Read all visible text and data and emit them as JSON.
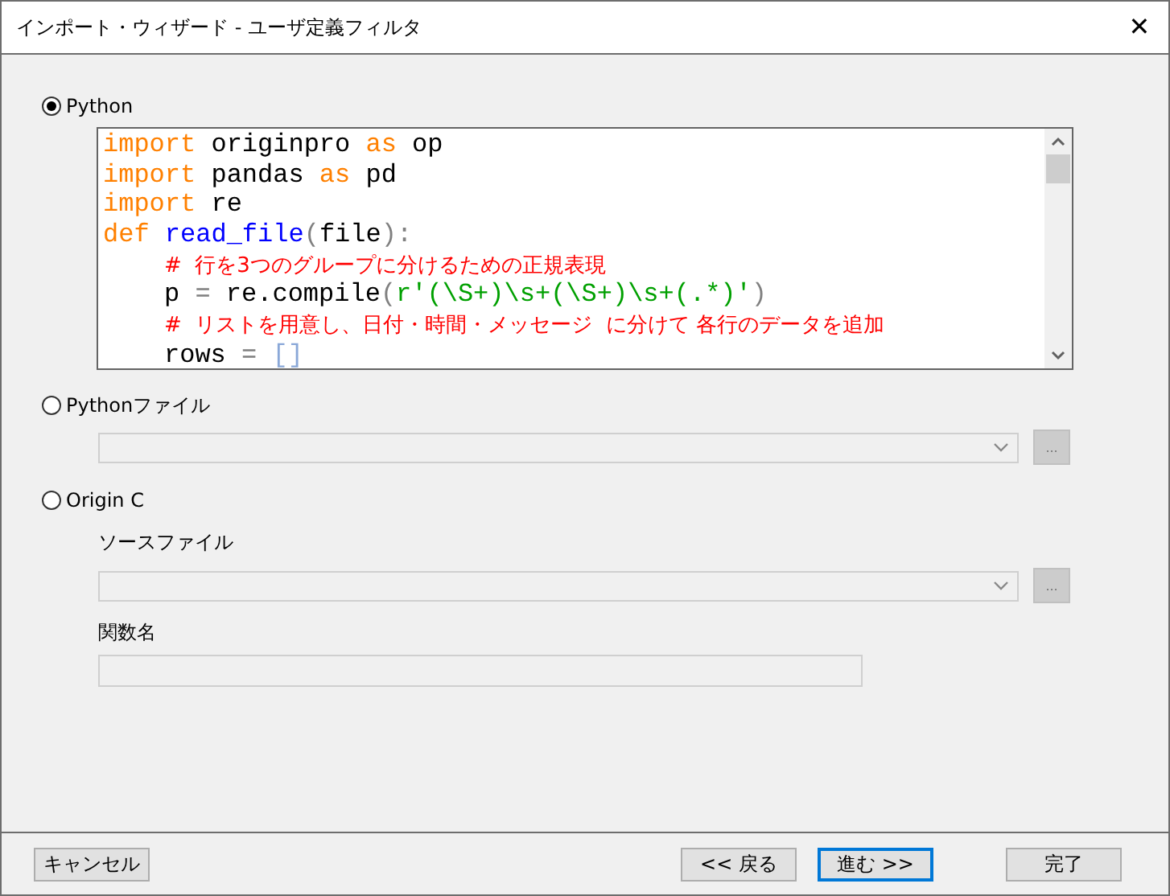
{
  "window": {
    "title": "インポート・ウィザード - ユーザ定義フィルタ",
    "close": "✕"
  },
  "sources": [
    {
      "kind": "code",
      "label": "Python",
      "selected": true,
      "code": [
        {
          "tokens": [
            {
              "kind": "kw",
              "text": "import"
            },
            {
              "kind": "id",
              "text": " originpro "
            },
            {
              "kind": "kw",
              "text": "as"
            },
            {
              "kind": "id",
              "text": " op"
            }
          ]
        },
        {
          "tokens": [
            {
              "kind": "kw",
              "text": "import"
            },
            {
              "kind": "id",
              "text": " pandas "
            },
            {
              "kind": "kw",
              "text": "as"
            },
            {
              "kind": "id",
              "text": " pd"
            }
          ]
        },
        {
          "tokens": [
            {
              "kind": "kw",
              "text": "import"
            },
            {
              "kind": "id",
              "text": " re"
            }
          ]
        },
        {
          "tokens": [
            {
              "kind": "kw",
              "text": "def"
            },
            {
              "kind": "fn",
              "text": " read_file"
            },
            {
              "kind": "punct",
              "text": "("
            },
            {
              "kind": "id",
              "text": "file"
            },
            {
              "kind": "punct",
              "text": "):"
            }
          ],
          "children": [
            {
              "tokens": [
                {
                  "kind": "comment",
                  "text": "#  行を3つのグループに分けるための正規表現"
                }
              ]
            },
            {
              "tokens": [
                {
                  "kind": "id",
                  "text": "p "
                },
                {
                  "kind": "punct",
                  "text": "="
                },
                {
                  "kind": "id",
                  "text": " re.compile"
                },
                {
                  "kind": "punct",
                  "text": "("
                },
                {
                  "kind": "str",
                  "text": "r'(\\S+)\\s+(\\S+)\\s+(.*)'"
                },
                {
                  "kind": "punct",
                  "text": ")"
                }
              ]
            },
            {
              "tokens": [
                {
                  "kind": "comment",
                  "text": "#  リストを用意し、日付・時間・メッセージ  に分けて 各行のデータを追加"
                }
              ]
            },
            {
              "tokens": [
                {
                  "kind": "id",
                  "text": "rows "
                },
                {
                  "kind": "punct",
                  "text": "="
                },
                {
                  "kind": "brk",
                  "text": " []"
                }
              ]
            }
          ]
        }
      ]
    },
    {
      "kind": "file",
      "label": "Pythonファイル",
      "selected": false,
      "browse": "..."
    },
    {
      "kind": "function",
      "label": "Origin C",
      "selected": false,
      "file_label": "ソースファイル",
      "browse": "...",
      "name_label": "関数名"
    }
  ],
  "buttons": [
    {
      "label": "キャンセル",
      "focused": false
    },
    {
      "label": "<< 戻る",
      "focused": false
    },
    {
      "label": "進む >>",
      "focused": true
    },
    {
      "label": "完了",
      "focused": false
    }
  ]
}
